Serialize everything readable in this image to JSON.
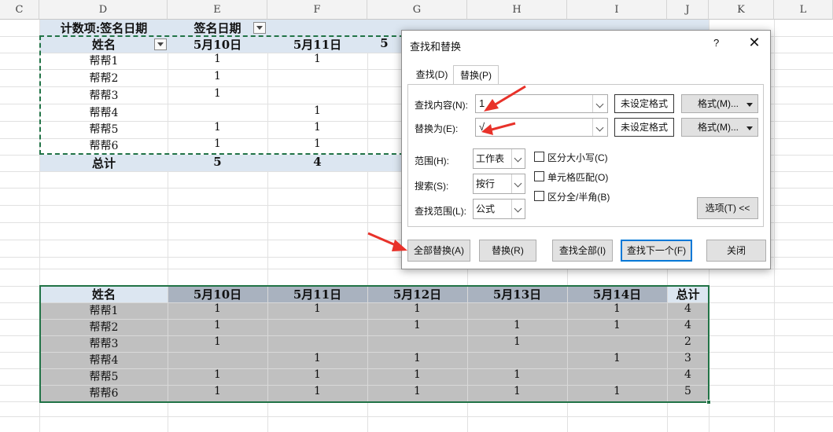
{
  "sheet": {
    "columns": [
      "C",
      "D",
      "E",
      "F",
      "G",
      "H",
      "I",
      "J",
      "K",
      "L"
    ]
  },
  "pivot": {
    "title_label": "计数项:签名日期",
    "col_field": "签名日期",
    "row_field": "姓名",
    "dates": [
      "5月10日",
      "5月11日",
      "5"
    ],
    "rows": [
      {
        "name": "帮帮1",
        "d1": "1",
        "d2": "1"
      },
      {
        "name": "帮帮2",
        "d1": "1",
        "d2": ""
      },
      {
        "name": "帮帮3",
        "d1": "1",
        "d2": ""
      },
      {
        "name": "帮帮4",
        "d1": "",
        "d2": "1"
      },
      {
        "name": "帮帮5",
        "d1": "1",
        "d2": "1"
      },
      {
        "name": "帮帮6",
        "d1": "1",
        "d2": "1"
      }
    ],
    "total_label": "总计",
    "totals": [
      "5",
      "4"
    ]
  },
  "table2": {
    "headers": [
      "姓名",
      "5月10日",
      "5月11日",
      "5月12日",
      "5月13日",
      "5月14日",
      "总计"
    ],
    "rows": [
      [
        "帮帮1",
        "1",
        "1",
        "1",
        "",
        "1",
        "4"
      ],
      [
        "帮帮2",
        "1",
        "",
        "1",
        "1",
        "1",
        "4"
      ],
      [
        "帮帮3",
        "1",
        "",
        "",
        "1",
        "",
        "2"
      ],
      [
        "帮帮4",
        "",
        "1",
        "1",
        "",
        "1",
        "3"
      ],
      [
        "帮帮5",
        "1",
        "1",
        "1",
        "1",
        "",
        "4"
      ],
      [
        "帮帮6",
        "1",
        "1",
        "1",
        "1",
        "1",
        "5"
      ]
    ]
  },
  "dialog": {
    "title": "查找和替换",
    "help": "?",
    "close": "✕",
    "tabs": [
      "查找(D)",
      "替换(P)"
    ],
    "find_label": "查找内容(N):",
    "find_value": "1",
    "replace_label": "替换为(E):",
    "replace_value": "√",
    "no_format": "未设定格式",
    "format_btn": "格式(M)...",
    "scope_label": "范围(H):",
    "scope_value": "工作表",
    "search_label": "搜索(S):",
    "search_value": "按行",
    "lookin_label": "查找范围(L):",
    "lookin_value": "公式",
    "match_case": "区分大小写(C)",
    "match_cell": "单元格匹配(O)",
    "match_width": "区分全/半角(B)",
    "options_btn": "选项(T) <<",
    "btn_replace_all": "全部替换(A)",
    "btn_replace": "替换(R)",
    "btn_find_all": "查找全部(I)",
    "btn_find_next": "查找下一个(F)",
    "btn_close": "关闭"
  },
  "colors": {
    "accent": "#217346",
    "arrow": "#e8322a",
    "pivot_header": "#dce6f1",
    "focus": "#0078d7"
  }
}
